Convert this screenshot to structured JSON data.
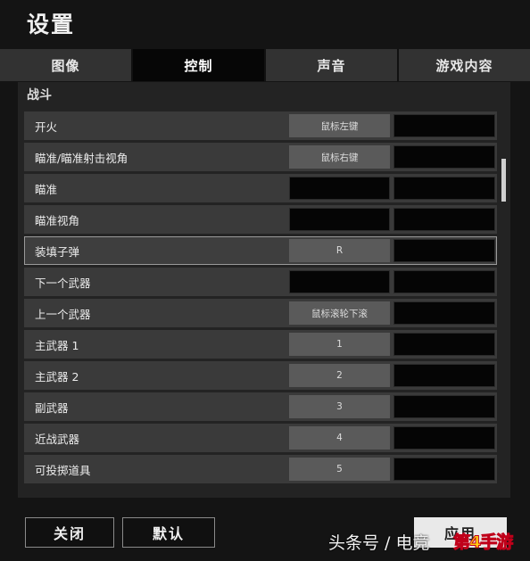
{
  "window": {
    "title": "设置"
  },
  "tabs": [
    {
      "label": "图像",
      "active": false
    },
    {
      "label": "控制",
      "active": true
    },
    {
      "label": "声音",
      "active": false
    },
    {
      "label": "游戏内容",
      "active": false
    }
  ],
  "section": {
    "title": "战斗"
  },
  "bindings": [
    {
      "action": "开火",
      "primary": "鼠标左键",
      "secondary": ""
    },
    {
      "action": "瞄准/瞄准射击视角",
      "primary": "鼠标右键",
      "secondary": ""
    },
    {
      "action": "瞄准",
      "primary": "",
      "secondary": ""
    },
    {
      "action": "瞄准视角",
      "primary": "",
      "secondary": ""
    },
    {
      "action": "装填子弹",
      "primary": "R",
      "secondary": ""
    },
    {
      "action": "下一个武器",
      "primary": "",
      "secondary": ""
    },
    {
      "action": "上一个武器",
      "primary": "鼠标滚轮下滚",
      "secondary": ""
    },
    {
      "action": "主武器 1",
      "primary": "1",
      "secondary": ""
    },
    {
      "action": "主武器 2",
      "primary": "2",
      "secondary": ""
    },
    {
      "action": "副武器",
      "primary": "3",
      "secondary": ""
    },
    {
      "action": "近战武器",
      "primary": "4",
      "secondary": ""
    },
    {
      "action": "可投掷道具",
      "primary": "5",
      "secondary": ""
    }
  ],
  "selected_row": "装填子弹",
  "footer": {
    "close_label": "关闭",
    "default_label": "默认",
    "apply_label": "应用"
  },
  "watermark": {
    "text": "头条号 / 电竞",
    "logo": "第4手游"
  },
  "colors": {
    "background": "#141414",
    "panel": "#232323",
    "key_filled": "#5a5a5a",
    "key_empty": "#050505",
    "logo": "#ffcf10"
  }
}
